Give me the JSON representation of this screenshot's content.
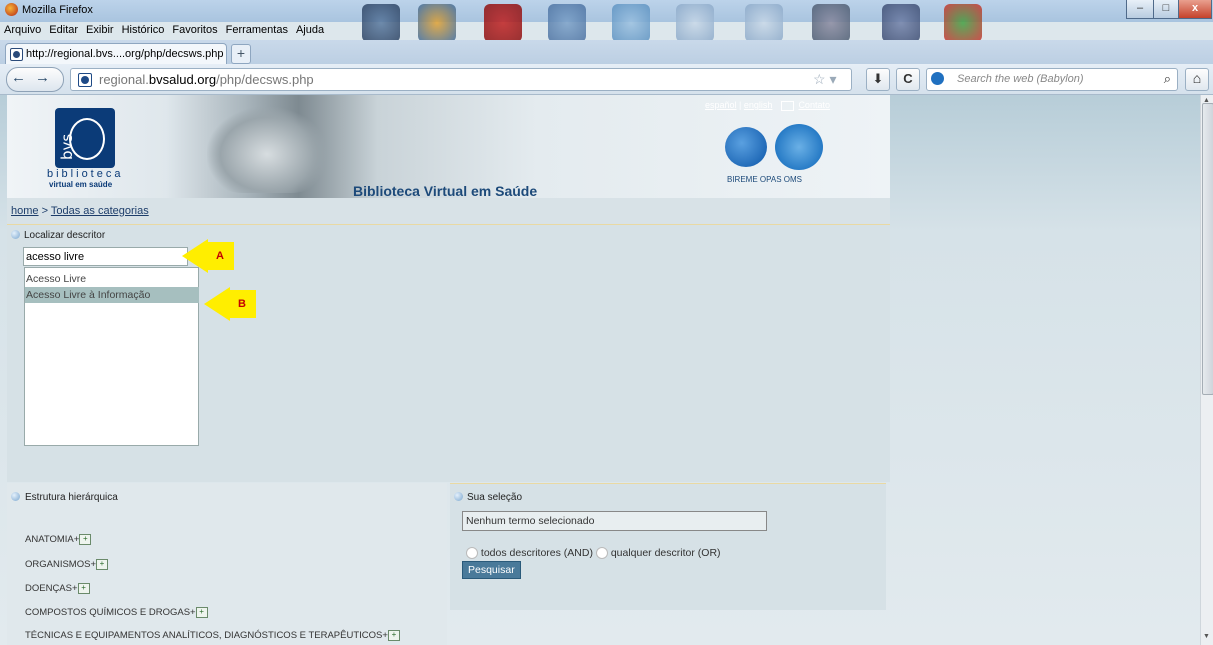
{
  "window": {
    "title": "Mozilla Firefox",
    "min_label": "–",
    "max_label": "□",
    "close_label": "x"
  },
  "menu": [
    "Arquivo",
    "Editar",
    "Exibir",
    "Histórico",
    "Favoritos",
    "Ferramentas",
    "Ajuda"
  ],
  "tab": {
    "label": "http://regional.bvs....org/php/decsws.php",
    "new_tab": "+"
  },
  "nav": {
    "back": "←",
    "forward": "→",
    "url_prefix": "regional.",
    "url_domain": "bvsalud.org",
    "url_path": "/php/decsws.php",
    "star": "☆ ▾",
    "download": "⬇",
    "reload": "C",
    "search_placeholder": "Search the web (Babylon)",
    "search_go": "⌕",
    "home": "⌂"
  },
  "site": {
    "logo_letters": "bvs",
    "logo_word": "biblioteca",
    "logo_sub": "virtual em saúde",
    "title": "Biblioteca Virtual em Saúde",
    "top_links": [
      "español",
      "english",
      "Contato"
    ],
    "org_names": "BIREME  OPAS  OMS"
  },
  "breadcrumb": {
    "home": "home",
    "separator": " > ",
    "current": "Todas as categorias"
  },
  "locator": {
    "title": "Localizar descritor",
    "input_value": "acesso livre",
    "results": [
      "Acesso Livre",
      "Acesso Livre à Informação"
    ],
    "annotation_a": "A",
    "annotation_b": "B"
  },
  "hierarchy": {
    "title": "Estrutura hierárquica",
    "categories": [
      "ANATOMIA+",
      "ORGANISMOS+",
      "DOENÇAS+",
      "COMPOSTOS QUÍMICOS E DROGAS+",
      "TÉCNICAS E EQUIPAMENTOS ANALÍTICOS, DIAGNÓSTICOS E TERAPÊUTICOS+"
    ]
  },
  "selection": {
    "title": "Sua seleção",
    "field_value": "Nenhum termo selecionado",
    "option_and": "todos descritores (AND)",
    "option_or": "qualquer descritor (OR)",
    "button": "Pesquisar"
  }
}
